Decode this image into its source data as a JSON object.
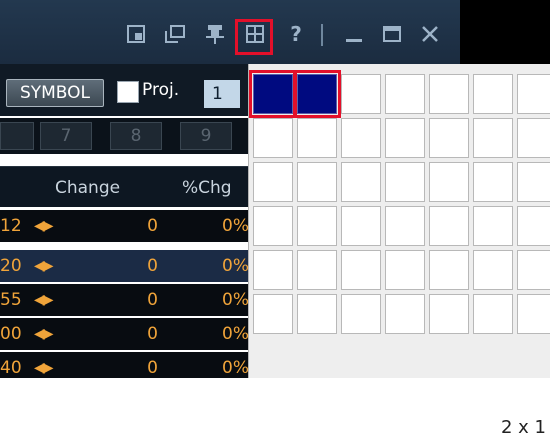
{
  "window": {
    "title_icons": [
      "restore-view-icon",
      "detach-window-icon",
      "pin-icon",
      "grid-layout-icon",
      "help-icon",
      "minimize-icon",
      "maximize-icon",
      "close-icon"
    ],
    "help_label": "?",
    "close_label": "✕"
  },
  "toolbar": {
    "symbol_label": "SYMBOL",
    "proj_label": "Proj.",
    "proj_value": "1"
  },
  "keys": [
    "7",
    "8",
    "9"
  ],
  "columns": {
    "change": "Change",
    "pct_change": "%Chg"
  },
  "rows": [
    {
      "price": "12",
      "change": "0",
      "pct": "0%"
    },
    {
      "price": "20",
      "change": "0",
      "pct": "0%"
    },
    {
      "price": "55",
      "change": "0",
      "pct": "0%"
    },
    {
      "price": "00",
      "change": "0",
      "pct": "0%"
    },
    {
      "price": "40",
      "change": "0",
      "pct": "0%"
    }
  ],
  "grid_picker": {
    "columns": 7,
    "rows": 6,
    "selected_columns": 2,
    "selected_rows": 1,
    "size_label": "2 x 1"
  },
  "colors": {
    "titlebar": "#1f3349",
    "highlight": "#e3102a",
    "selected_cell": "#000a80",
    "value_text": "#f0a43a"
  }
}
